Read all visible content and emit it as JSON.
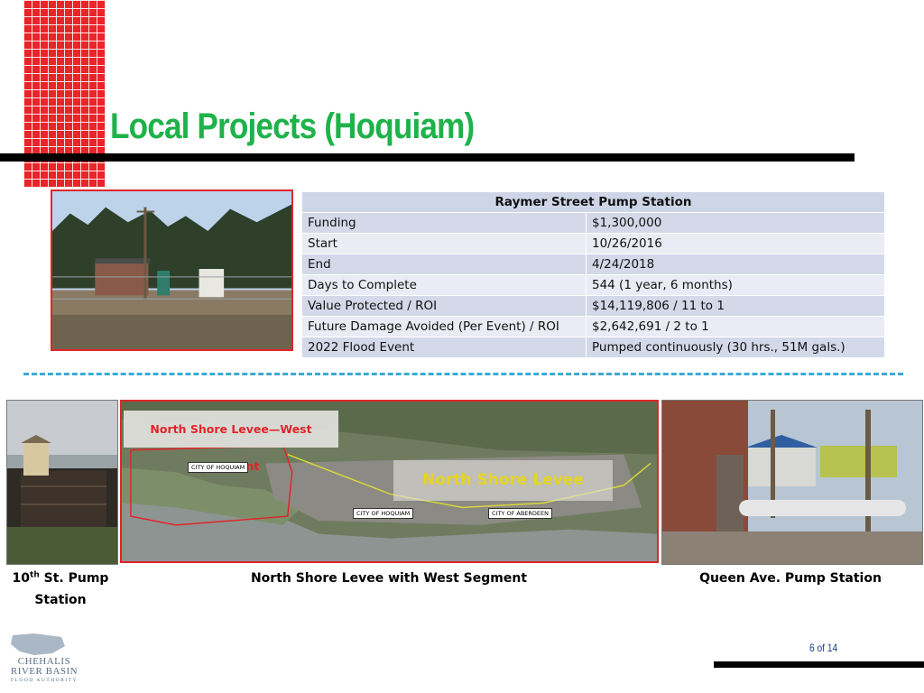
{
  "slide": {
    "title": "Local Projects (Hoquiam)",
    "page_number": "6 of 14",
    "accent_colors": {
      "title": "#1eb24a",
      "grid_block": "#e8262a",
      "dash_line": "#3aaad8",
      "photo_border": "#e0252a"
    }
  },
  "table": {
    "header": "Raymer Street Pump Station",
    "rows": [
      {
        "label": "Funding",
        "value": "$1,300,000"
      },
      {
        "label": "Start",
        "value": "10/26/2016"
      },
      {
        "label": "End",
        "value": "4/24/2018"
      },
      {
        "label": "Days to Complete",
        "value": "544 (1 year, 6 months)"
      },
      {
        "label": "Value Protected / ROI",
        "value": "$14,119,806 / 11 to 1"
      },
      {
        "label": "Future Damage Avoided (Per Event) / ROI",
        "value": "$2,642,691 / 2 to 1"
      },
      {
        "label": "2022 Flood Event",
        "value": "Pumped continuously (30 hrs., 51M gals.)"
      }
    ]
  },
  "map": {
    "label_west": "North Shore Levee—West Segment",
    "label_levee": "North Shore Levee",
    "city_labels": [
      "CITY OF HOQUIAM",
      "CITY OF HOQUIAM",
      "CITY OF ABERDEEN"
    ]
  },
  "captions": {
    "left_prefix": "10",
    "left_sup": "th",
    "left_rest": " St. Pump Station",
    "middle": "North Shore Levee with West Segment",
    "right": "Queen Ave. Pump Station"
  },
  "logo": {
    "line1": "CHEHALIS",
    "line2": "RIVER BASIN",
    "line3": "FLOOD AUTHORITY"
  }
}
